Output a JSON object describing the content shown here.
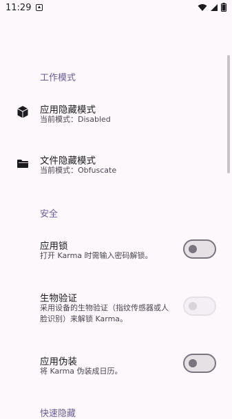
{
  "status_bar": {
    "time": "11:29",
    "icons": [
      "notification-icon",
      "wifi-icon",
      "signal-icon",
      "battery-icon"
    ]
  },
  "sections": {
    "work_mode": {
      "title": "工作模式",
      "items": [
        {
          "title": "应用隐藏模式",
          "subtitle": "当前模式：Disabled",
          "icon": "cube-icon"
        },
        {
          "title": "文件隐藏模式",
          "subtitle": "当前模式：Obfuscate",
          "icon": "folder-icon"
        }
      ]
    },
    "security": {
      "title": "安全",
      "items": [
        {
          "title": "应用锁",
          "subtitle": "打开 Karma 时需输入密码解锁。",
          "switch_on": false,
          "enabled": true
        },
        {
          "title": "生物验证",
          "subtitle_line1": "采用设备的生物验证（指纹传感器或人",
          "subtitle_line2": "脸识别）来解锁 Karma。",
          "switch_on": false,
          "enabled": false
        },
        {
          "title": "应用伪装",
          "subtitle": "将 Karma 伪装成日历。",
          "switch_on": false,
          "enabled": true
        }
      ]
    },
    "quick_hide": {
      "title": "快速隐藏"
    }
  },
  "colors": {
    "accent": "#6b5b95",
    "background": "#fdf8fc",
    "text": "#1c1b1f",
    "subtext": "#49454f"
  }
}
